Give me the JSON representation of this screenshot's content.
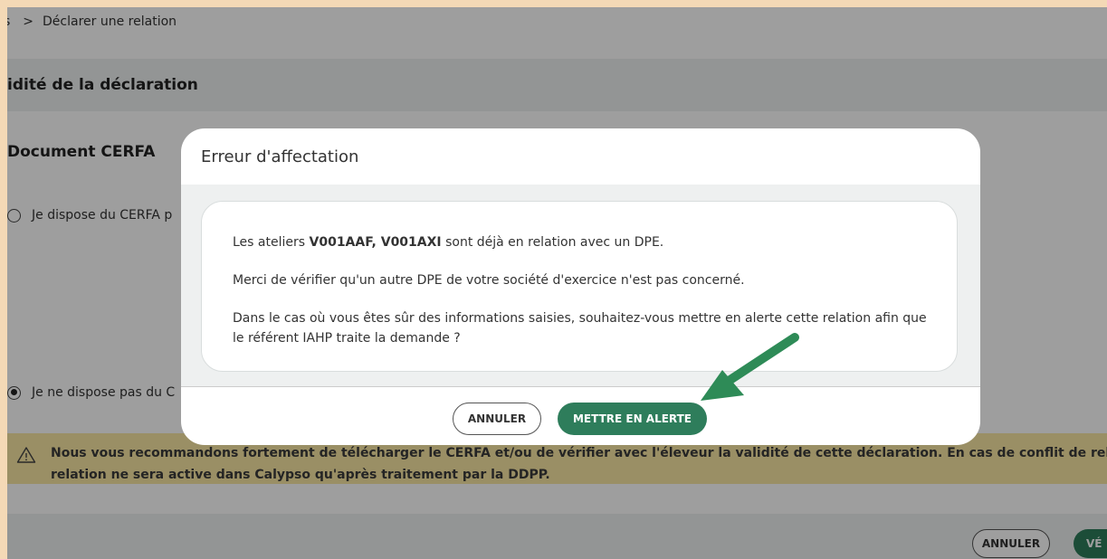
{
  "breadcrumb": {
    "prev": "s",
    "separator": ">",
    "current": "Déclarer une relation"
  },
  "section": {
    "title": "idité de la déclaration"
  },
  "cerfa": {
    "title": "Document CERFA",
    "option_have": "Je dispose du CERFA p",
    "option_not_have": "Je ne dispose pas du C"
  },
  "warning": {
    "line1": "Nous vous recommandons fortement de télécharger le CERFA et/ou de vérifier avec l'éleveur la validité de cette déclaration. En cas de conflit de relation avec un",
    "line2": "relation ne sera active dans Calypso qu'après traitement par la DDPP."
  },
  "footer": {
    "cancel_label": "ANNULER",
    "verify_label": "VÉ"
  },
  "modal": {
    "title": "Erreur d'affectation",
    "msg1_pre": "Les ateliers ",
    "msg1_bold": "V001AAF, V001AXI",
    "msg1_post": " sont déjà en relation avec un DPE.",
    "msg2": "Merci de vérifier qu'un autre DPE de votre société d'exercice n'est pas concerné.",
    "msg3": "Dans le cas où vous êtes sûr des informations saisies, souhaitez-vous mettre en alerte cette relation afin que le référent IAHP traite la demande ?",
    "cancel_label": "ANNULER",
    "alert_label": "METTRE EN ALERTE"
  },
  "colors": {
    "accent_green": "#2e7d5b",
    "warning_bg": "#f8e7a3",
    "arrow": "#2e8b57"
  },
  "icons": {
    "warning": "warning-triangle-icon",
    "arrow": "pointer-arrow-icon"
  }
}
